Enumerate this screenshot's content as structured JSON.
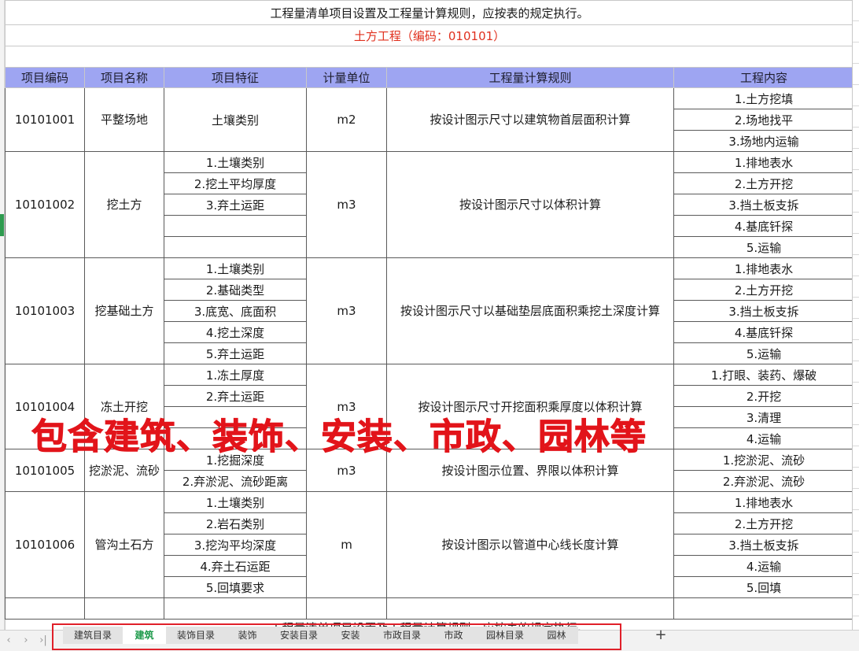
{
  "sheet": {
    "title": "工程量清单项目设置及工程量计算规则，应按表的规定执行。",
    "subtitle": "土方工程（编码：010101）",
    "headers": [
      "项目编码",
      "项目名称",
      "项目特征",
      "计量单位",
      "工程量计算规则",
      "工程内容"
    ],
    "items": [
      {
        "code": "10101001",
        "name": "平整场地",
        "features": [
          "土壤类别"
        ],
        "unit": "m2",
        "rule": "按设计图示尺寸以建筑物首层面积计算",
        "contents": [
          "1.土方挖填",
          "2.场地找平",
          "3.场地内运输"
        ]
      },
      {
        "code": "10101002",
        "name": "挖土方",
        "features": [
          "1.土壤类别",
          "2.挖土平均厚度",
          "3.弃土运距",
          "",
          ""
        ],
        "unit": "m3",
        "rule": "按设计图示尺寸以体积计算",
        "contents": [
          "1.排地表水",
          "2.土方开挖",
          "3.挡土板支拆",
          "4.基底钎探",
          "5.运输"
        ]
      },
      {
        "code": "10101003",
        "name": "挖基础土方",
        "features": [
          "1.土壤类别",
          "2.基础类型",
          "3.底宽、底面积",
          "4.挖土深度",
          "5.弃土运距"
        ],
        "unit": "m3",
        "rule": "按设计图示尺寸以基础垫层底面积乘挖土深度计算",
        "contents": [
          "1.排地表水",
          "2.土方开挖",
          "3.挡土板支拆",
          "4.基底钎探",
          "5.运输"
        ]
      },
      {
        "code": "10101004",
        "name": "冻土开挖",
        "features": [
          "1.冻土厚度",
          "2.弃土运距",
          "",
          ""
        ],
        "unit": "m3",
        "rule": "按设计图示尺寸开挖面积乘厚度以体积计算",
        "contents": [
          "1.打眼、装药、爆破",
          "2.开挖",
          "3.清理",
          "4.运输"
        ]
      },
      {
        "code": "10101005",
        "name": "挖淤泥、流砂",
        "features": [
          "1.挖掘深度",
          "2.弃淤泥、流砂距离"
        ],
        "unit": "m3",
        "rule": "按设计图示位置、界限以体积计算",
        "contents": [
          "1.挖淤泥、流砂",
          "2.弃淤泥、流砂"
        ]
      },
      {
        "code": "10101006",
        "name": "管沟土石方",
        "features": [
          "1.土壤类别",
          "2.岩石类别",
          "3.挖沟平均深度",
          "4.弃土石运距",
          "5.回填要求"
        ],
        "unit": "m",
        "rule": "按设计图示以管道中心线长度计算",
        "contents": [
          "1.排地表水",
          "2.土方开挖",
          "3.挡土板支拆",
          "4.运输",
          "5.回填"
        ]
      }
    ],
    "footer_title": "工程量清单项目设置及工程量计算规则，应按表的规定执行。"
  },
  "overlay": {
    "text": "包含建筑、装饰、安装、市政、园林等",
    "color": "#e2141a"
  },
  "tabbar": {
    "nav": [
      "‹",
      "›",
      "›|"
    ],
    "tabs": [
      "建筑目录",
      "建筑",
      "装饰目录",
      "装饰",
      "安装目录",
      "安装",
      "市政目录",
      "市政",
      "园林目录",
      "园林"
    ],
    "active_tab": "建筑",
    "add_label": "+"
  },
  "colors": {
    "header_bg": "#9ea5f2",
    "subtitle": "#e0301e",
    "active_tab": "#1d9a4a",
    "frame": "#e0202a"
  }
}
